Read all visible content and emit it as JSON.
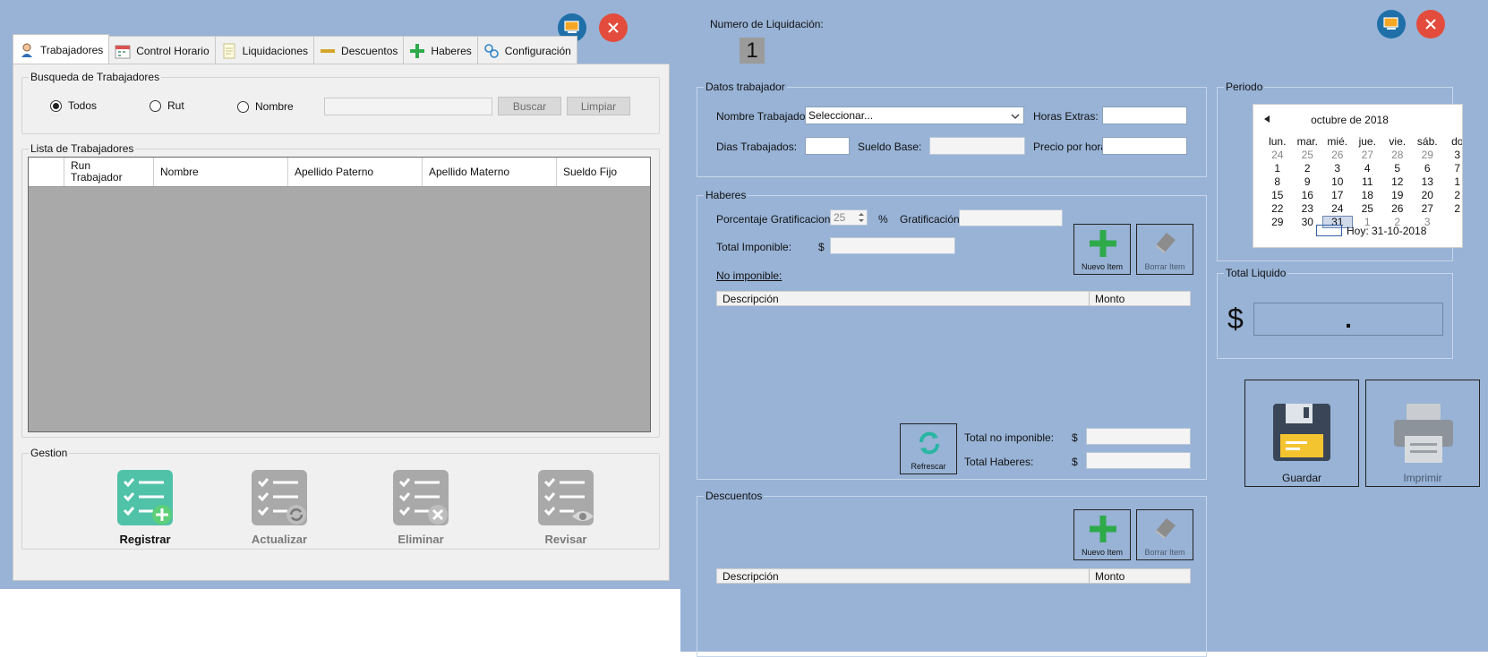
{
  "left": {
    "tabs": [
      {
        "label": "Trabajadores",
        "icon": "worker-icon"
      },
      {
        "label": "Control Horario",
        "icon": "calendar-icon"
      },
      {
        "label": "Liquidaciones",
        "icon": "document-icon"
      },
      {
        "label": "Descuentos",
        "icon": "minus-icon"
      },
      {
        "label": "Haberes",
        "icon": "plus-icon"
      },
      {
        "label": "Configuración",
        "icon": "gears-icon"
      }
    ],
    "search": {
      "title": "Busqueda de Trabajadores",
      "options": [
        "Todos",
        "Rut",
        "Nombre"
      ],
      "selected": "Todos",
      "value": "",
      "search_btn": "Buscar",
      "clear_btn": "Limpiar"
    },
    "list": {
      "title": "Lista de Trabajadores",
      "columns": [
        "Run Trabajador",
        "Nombre",
        "Apellido Paterno",
        "Apellido Materno",
        "Sueldo Fijo"
      ],
      "col_run_line1": "Run",
      "col_run_line2": "Trabajador",
      "rows": []
    },
    "gestion": {
      "title": "Gestion",
      "buttons": [
        {
          "label": "Registrar",
          "icon": "checklist-add-icon"
        },
        {
          "label": "Actualizar",
          "icon": "checklist-refresh-icon"
        },
        {
          "label": "Eliminar",
          "icon": "checklist-delete-icon"
        },
        {
          "label": "Revisar",
          "icon": "checklist-view-icon"
        }
      ]
    }
  },
  "right": {
    "numero_label": "Numero de Liquidación:",
    "numero_value": "1",
    "datos": {
      "title": "Datos trabajador",
      "nombre_label": "Nombre Trabajador:",
      "nombre_value": "Seleccionar...",
      "horas_label": "Horas Extras:",
      "dias_label": "Dias Trabajados:",
      "sueldo_label": "Sueldo Base:",
      "precio_label": "Precio por hora:"
    },
    "haberes": {
      "title": "Haberes",
      "porcentaje_label": "Porcentaje Gratificacion:",
      "porcentaje_value": "25",
      "percent_sign": "%",
      "gratificacion_label": "Gratificación:",
      "imponible_label": "Total Imponible:",
      "currency": "$",
      "no_imponible_label": "No imponible:",
      "nuevo_item": "Nuevo Item",
      "borrar_item": "Borrar Item",
      "col_desc": "Descripción",
      "col_monto": "Monto",
      "refrescar": "Refrescar",
      "total_no_imponible_label": "Total no imponible:",
      "total_haberes_label": "Total Haberes:"
    },
    "descuentos": {
      "title": "Descuentos",
      "nuevo_item": "Nuevo Item",
      "borrar_item": "Borrar Item",
      "col_desc": "Descripción",
      "col_monto": "Monto"
    },
    "periodo": {
      "title": "Periodo",
      "month": "octubre de 2018",
      "weekdays": [
        "lun.",
        "mar.",
        "mié.",
        "jue.",
        "vie.",
        "sáb.",
        "do"
      ],
      "weeks": [
        [
          "24",
          "25",
          "26",
          "27",
          "28",
          "29",
          "3"
        ],
        [
          "1",
          "2",
          "3",
          "4",
          "5",
          "6",
          "7"
        ],
        [
          "8",
          "9",
          "10",
          "11",
          "12",
          "13",
          "1"
        ],
        [
          "15",
          "16",
          "17",
          "18",
          "19",
          "20",
          "2"
        ],
        [
          "22",
          "23",
          "24",
          "25",
          "26",
          "27",
          "2"
        ],
        [
          "29",
          "30",
          "31",
          "1",
          "2",
          "3",
          ""
        ]
      ],
      "today": "Hoy: 31-10-2018"
    },
    "total_liquido": {
      "title": "Total Liquido",
      "currency": "$",
      "value": "."
    },
    "guardar": "Guardar",
    "imprimir": "Imprimir"
  }
}
